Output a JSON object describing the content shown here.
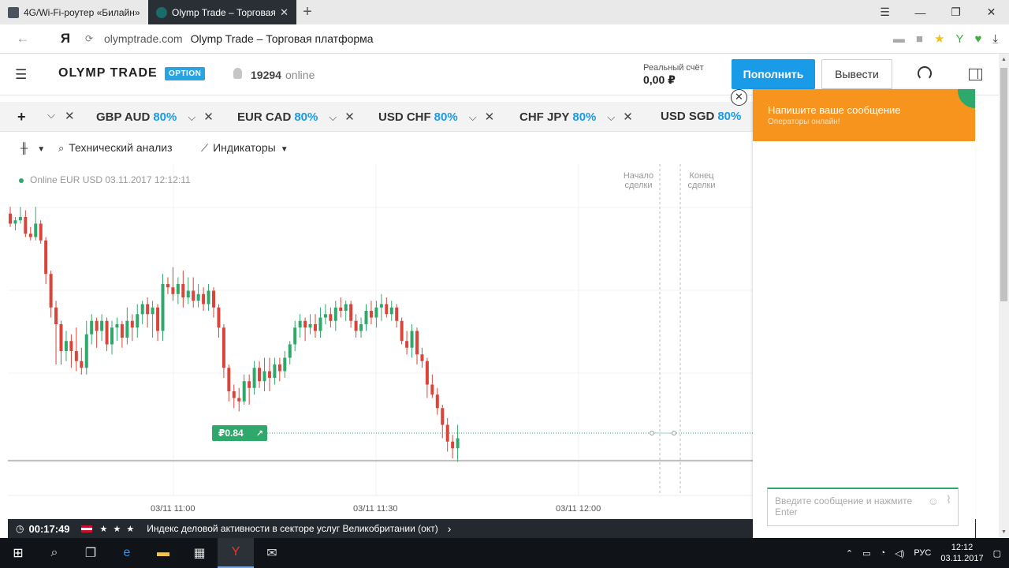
{
  "browser": {
    "tabs": [
      {
        "title": "4G/Wi-Fi-роутер «Билайн»"
      },
      {
        "title": "Olymp Trade – Торговая"
      }
    ],
    "new_tab": "+",
    "url": "olymptrade.com",
    "page_title": "Olymp Trade – Торговая платформа",
    "yandex_logo": "Я"
  },
  "header": {
    "logo": "OLYMP TRADE",
    "option_badge": "OPTION",
    "online_count": "19294",
    "online_label": "online",
    "account_label": "Реальный счёт",
    "balance": "0,00 ₽",
    "deposit_label": "Пополнить",
    "withdraw_label": "Вывести"
  },
  "assets": {
    "items": [
      {
        "name": "GBP AUD",
        "payout": "80%"
      },
      {
        "name": "EUR CAD",
        "payout": "80%"
      },
      {
        "name": "USD CHF",
        "payout": "80%"
      },
      {
        "name": "CHF JPY",
        "payout": "80%"
      },
      {
        "name": "USD SGD",
        "payout": "80%"
      }
    ]
  },
  "toolbar": {
    "tech_analysis": "Технический анализ",
    "indicators": "Индикаторы"
  },
  "chart": {
    "status": "Online EUR USD 03.11.2017 12:12:11",
    "deal_start": "Начало сделки",
    "deal_end": "Конец сделки",
    "price_tag": "₽0.84",
    "time_labels": [
      "03/11 11:00",
      "03/11 11:30",
      "03/11 12:00"
    ]
  },
  "chart_data": {
    "type": "candlestick",
    "title": "",
    "xlabel": "",
    "ylabel": "",
    "x_ticks": [
      "03/11 11:00",
      "03/11 11:30",
      "03/11 12:00"
    ],
    "grid": true,
    "candles": [
      {
        "o": 3,
        "c": 6,
        "h": 1,
        "l": 7
      },
      {
        "o": 6,
        "c": 5,
        "h": 4,
        "l": 8
      },
      {
        "o": 5,
        "c": 4,
        "h": 1,
        "l": 6
      },
      {
        "o": 4,
        "c": 9,
        "h": 2,
        "l": 10
      },
      {
        "o": 9,
        "c": 10,
        "h": 7,
        "l": 11
      },
      {
        "o": 10,
        "c": 6,
        "h": 1,
        "l": 11
      },
      {
        "o": 6,
        "c": 11,
        "h": 5,
        "l": 12
      },
      {
        "o": 11,
        "c": 21,
        "h": 10,
        "l": 24
      },
      {
        "o": 21,
        "c": 31,
        "h": 20,
        "l": 34
      },
      {
        "o": 31,
        "c": 36,
        "h": 29,
        "l": 48
      },
      {
        "o": 36,
        "c": 44,
        "h": 35,
        "l": 48
      },
      {
        "o": 44,
        "c": 41,
        "h": 38,
        "l": 47
      },
      {
        "o": 41,
        "c": 44,
        "h": 39,
        "l": 49
      },
      {
        "o": 44,
        "c": 47,
        "h": 37,
        "l": 50
      },
      {
        "o": 47,
        "c": 49,
        "h": 43,
        "l": 51
      },
      {
        "o": 49,
        "c": 39,
        "h": 35,
        "l": 51
      },
      {
        "o": 39,
        "c": 35,
        "h": 33,
        "l": 42
      },
      {
        "o": 35,
        "c": 38,
        "h": 34,
        "l": 43
      },
      {
        "o": 38,
        "c": 35,
        "h": 33,
        "l": 41
      },
      {
        "o": 35,
        "c": 42,
        "h": 34,
        "l": 44
      },
      {
        "o": 42,
        "c": 37,
        "h": 35,
        "l": 45
      },
      {
        "o": 37,
        "c": 36,
        "h": 34,
        "l": 41
      },
      {
        "o": 36,
        "c": 40,
        "h": 35,
        "l": 43
      },
      {
        "o": 40,
        "c": 35,
        "h": 31,
        "l": 42
      },
      {
        "o": 35,
        "c": 37,
        "h": 33,
        "l": 41
      },
      {
        "o": 37,
        "c": 33,
        "h": 30,
        "l": 40
      },
      {
        "o": 33,
        "c": 30,
        "h": 29,
        "l": 36
      },
      {
        "o": 30,
        "c": 33,
        "h": 28,
        "l": 37
      },
      {
        "o": 33,
        "c": 31,
        "h": 29,
        "l": 40
      },
      {
        "o": 31,
        "c": 38,
        "h": 30,
        "l": 41
      },
      {
        "o": 38,
        "c": 24,
        "h": 21,
        "l": 41
      },
      {
        "o": 24,
        "c": 25,
        "h": 22,
        "l": 27
      },
      {
        "o": 25,
        "c": 27,
        "h": 19,
        "l": 29
      },
      {
        "o": 27,
        "c": 24,
        "h": 22,
        "l": 30
      },
      {
        "o": 24,
        "c": 28,
        "h": 20,
        "l": 31
      },
      {
        "o": 28,
        "c": 26,
        "h": 22,
        "l": 30
      },
      {
        "o": 26,
        "c": 29,
        "h": 22,
        "l": 31
      },
      {
        "o": 29,
        "c": 27,
        "h": 24,
        "l": 31
      },
      {
        "o": 27,
        "c": 30,
        "h": 25,
        "l": 32
      },
      {
        "o": 30,
        "c": 26,
        "h": 24,
        "l": 32
      },
      {
        "o": 26,
        "c": 31,
        "h": 25,
        "l": 34
      },
      {
        "o": 31,
        "c": 37,
        "h": 30,
        "l": 40
      },
      {
        "o": 37,
        "c": 49,
        "h": 36,
        "l": 52
      },
      {
        "o": 49,
        "c": 56,
        "h": 48,
        "l": 59
      },
      {
        "o": 56,
        "c": 58,
        "h": 54,
        "l": 61
      },
      {
        "o": 58,
        "c": 59,
        "h": 55,
        "l": 62
      },
      {
        "o": 59,
        "c": 53,
        "h": 51,
        "l": 60
      },
      {
        "o": 53,
        "c": 55,
        "h": 51,
        "l": 60
      },
      {
        "o": 55,
        "c": 49,
        "h": 47,
        "l": 57
      },
      {
        "o": 49,
        "c": 53,
        "h": 47,
        "l": 55
      },
      {
        "o": 53,
        "c": 50,
        "h": 46,
        "l": 56
      },
      {
        "o": 50,
        "c": 52,
        "h": 46,
        "l": 56
      },
      {
        "o": 52,
        "c": 48,
        "h": 46,
        "l": 54
      },
      {
        "o": 48,
        "c": 50,
        "h": 46,
        "l": 53
      },
      {
        "o": 50,
        "c": 46,
        "h": 44,
        "l": 52
      },
      {
        "o": 46,
        "c": 42,
        "h": 41,
        "l": 48
      },
      {
        "o": 42,
        "c": 37,
        "h": 35,
        "l": 44
      },
      {
        "o": 37,
        "c": 35,
        "h": 33,
        "l": 40
      },
      {
        "o": 35,
        "c": 37,
        "h": 34,
        "l": 41
      },
      {
        "o": 37,
        "c": 36,
        "h": 33,
        "l": 39
      },
      {
        "o": 36,
        "c": 38,
        "h": 33,
        "l": 40
      },
      {
        "o": 38,
        "c": 34,
        "h": 31,
        "l": 40
      },
      {
        "o": 34,
        "c": 33,
        "h": 30,
        "l": 36
      },
      {
        "o": 33,
        "c": 35,
        "h": 31,
        "l": 37
      },
      {
        "o": 35,
        "c": 31,
        "h": 29,
        "l": 38
      },
      {
        "o": 31,
        "c": 32,
        "h": 28,
        "l": 34
      },
      {
        "o": 32,
        "c": 30,
        "h": 29,
        "l": 35
      },
      {
        "o": 30,
        "c": 35,
        "h": 29,
        "l": 37
      },
      {
        "o": 35,
        "c": 38,
        "h": 33,
        "l": 40
      },
      {
        "o": 38,
        "c": 36,
        "h": 34,
        "l": 40
      },
      {
        "o": 36,
        "c": 32,
        "h": 30,
        "l": 38
      },
      {
        "o": 32,
        "c": 34,
        "h": 29,
        "l": 36
      },
      {
        "o": 34,
        "c": 31,
        "h": 29,
        "l": 37
      },
      {
        "o": 31,
        "c": 30,
        "h": 27,
        "l": 35
      },
      {
        "o": 30,
        "c": 33,
        "h": 28,
        "l": 34
      },
      {
        "o": 33,
        "c": 31,
        "h": 29,
        "l": 35
      },
      {
        "o": 31,
        "c": 35,
        "h": 30,
        "l": 37
      },
      {
        "o": 35,
        "c": 41,
        "h": 34,
        "l": 42
      },
      {
        "o": 41,
        "c": 43,
        "h": 38,
        "l": 45
      },
      {
        "o": 43,
        "c": 38,
        "h": 36,
        "l": 46
      },
      {
        "o": 38,
        "c": 45,
        "h": 37,
        "l": 48
      },
      {
        "o": 45,
        "c": 47,
        "h": 43,
        "l": 49
      },
      {
        "o": 47,
        "c": 54,
        "h": 46,
        "l": 58
      },
      {
        "o": 54,
        "c": 57,
        "h": 51,
        "l": 58
      },
      {
        "o": 57,
        "c": 61,
        "h": 55,
        "l": 63
      },
      {
        "o": 61,
        "c": 66,
        "h": 60,
        "l": 70
      },
      {
        "o": 66,
        "c": 71,
        "h": 64,
        "l": 74
      },
      {
        "o": 71,
        "c": 73,
        "h": 69,
        "l": 76
      },
      {
        "o": 73,
        "c": 70,
        "h": 66,
        "l": 77
      }
    ]
  },
  "ticker": {
    "time": "00:17:49",
    "bulls": "★ ★ ★",
    "news": "Индекс деловой активности в секторе услуг Великобритании (окт)"
  },
  "chat": {
    "title": "Напишите ваше сообщение",
    "subtitle": "Операторы онлайн!",
    "input_placeholder": "Введите сообщение и нажмите Enter"
  },
  "taskbar": {
    "language": "РУС",
    "time": "12:12",
    "date": "03.11.2017"
  },
  "colors": {
    "bull": "#2ea96b",
    "bear": "#d9453a",
    "accent": "#1a9be8",
    "chat_header": "#f7941d"
  }
}
